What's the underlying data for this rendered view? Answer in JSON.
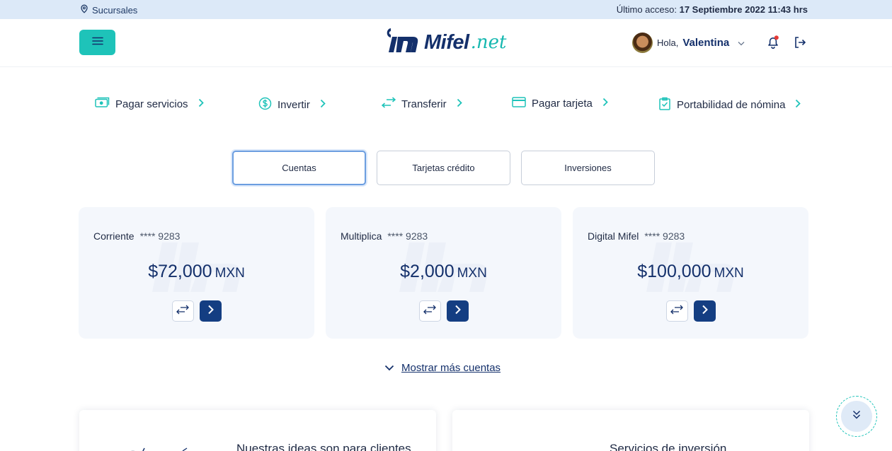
{
  "topbar": {
    "branches_label": "Sucursales",
    "last_access_label": "Último acceso:",
    "last_access_value": "17 Septiembre 2022 11:43 hrs"
  },
  "header": {
    "logo_main": "Mifel",
    "logo_suffix": ".net",
    "greeting": "Hola,",
    "user_name": "Valentina"
  },
  "quick_actions": [
    {
      "label": "Pagar servicios",
      "icon": "cash-icon"
    },
    {
      "label": "Invertir",
      "icon": "dollar-circle-icon"
    },
    {
      "label": "Transferir",
      "icon": "transfer-icon"
    },
    {
      "label": "Pagar tarjeta",
      "icon": "credit-card-icon"
    },
    {
      "label": "Portabilidad de nómina",
      "icon": "clipboard-check-icon"
    }
  ],
  "tabs": [
    {
      "label": "Cuentas",
      "active": true
    },
    {
      "label": "Tarjetas crédito",
      "active": false
    },
    {
      "label": "Inversiones",
      "active": false
    }
  ],
  "accounts": [
    {
      "name": "Corriente",
      "number": "**** 9283",
      "amount": "$72,000",
      "currency": "MXN"
    },
    {
      "name": "Multiplica",
      "number": "**** 9283",
      "amount": "$2,000",
      "currency": "MXN"
    },
    {
      "name": "Digital Mifel",
      "number": "**** 9283",
      "amount": "$100,000",
      "currency": "MXN"
    }
  ],
  "show_more_label": "Mostrar más cuentas",
  "panels": [
    {
      "text": "Nuestras ideas son para clientes"
    },
    {
      "text": "Servicios de inversión"
    }
  ],
  "colors": {
    "accent": "#1ec3b9",
    "brand": "#14306b",
    "topbar": "#dce9f8",
    "card_bg": "#f4f7fc",
    "notification_dot": "#e53935"
  }
}
